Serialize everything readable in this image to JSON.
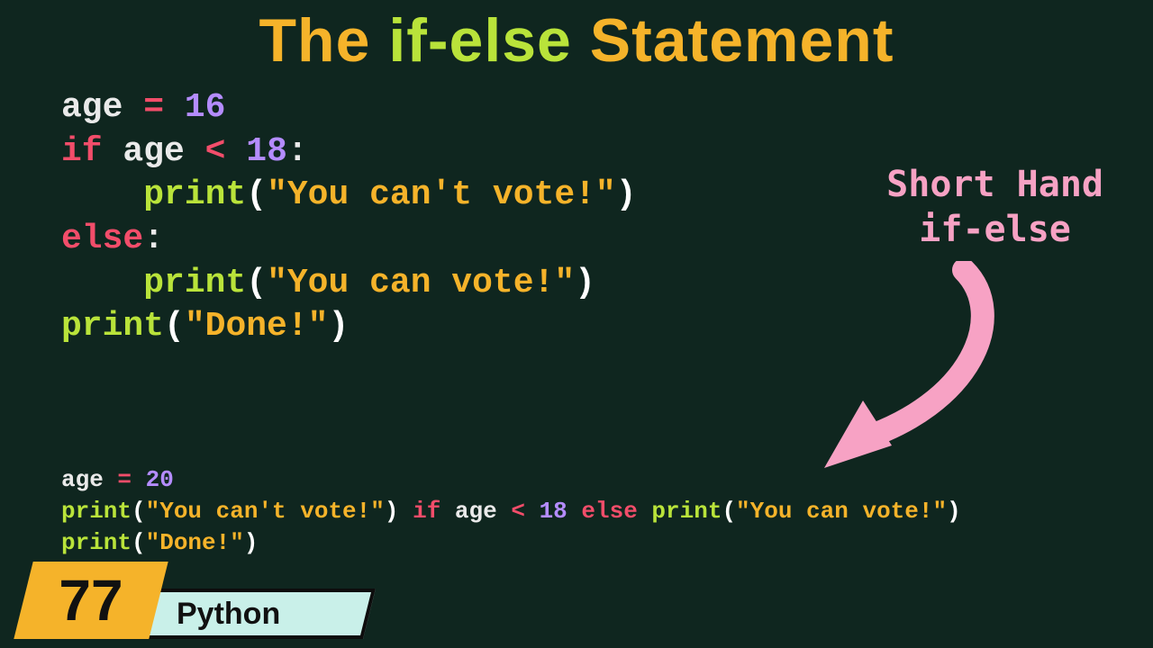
{
  "title": {
    "w1": "The ",
    "w2": "if-else ",
    "w3": "Statement"
  },
  "code1": {
    "l1": {
      "a": "age ",
      "op": "=",
      "sp": " ",
      "n": "16"
    },
    "l2": {
      "kw": "if",
      "sp1": " ",
      "v": "age ",
      "op": "<",
      "sp2": " ",
      "n": "18",
      "colon": ":"
    },
    "l3": {
      "indent": "    ",
      "fn": "print",
      "lp": "(",
      "s": "\"You can't vote!\"",
      "rp": ")"
    },
    "l4": {
      "kw": "else",
      "colon": ":"
    },
    "l5": {
      "indent": "    ",
      "fn": "print",
      "lp": "(",
      "s": "\"You can vote!\"",
      "rp": ")"
    },
    "l6": {
      "fn": "print",
      "lp": "(",
      "s": "\"Done!\"",
      "rp": ")"
    }
  },
  "code2": {
    "l1": {
      "a": "age ",
      "op": "=",
      "sp": " ",
      "n": "20"
    },
    "l2": {
      "fn1": "print",
      "lp1": "(",
      "s1": "\"You can't vote!\"",
      "rp1": ")",
      "sp1": " ",
      "kw1": "if",
      "sp2": " ",
      "v": "age ",
      "op": "<",
      "sp3": " ",
      "n": "18",
      "sp4": " ",
      "kw2": "else",
      "sp5": " ",
      "fn2": "print",
      "lp2": "(",
      "s2": "\"You can vote!\"",
      "rp2": ")"
    },
    "l3": {
      "fn": "print",
      "lp": "(",
      "s": "\"Done!\"",
      "rp": ")"
    }
  },
  "annotation": {
    "line1": "Short Hand",
    "line2": "if-else"
  },
  "badge": {
    "number": "77",
    "language": "Python"
  }
}
